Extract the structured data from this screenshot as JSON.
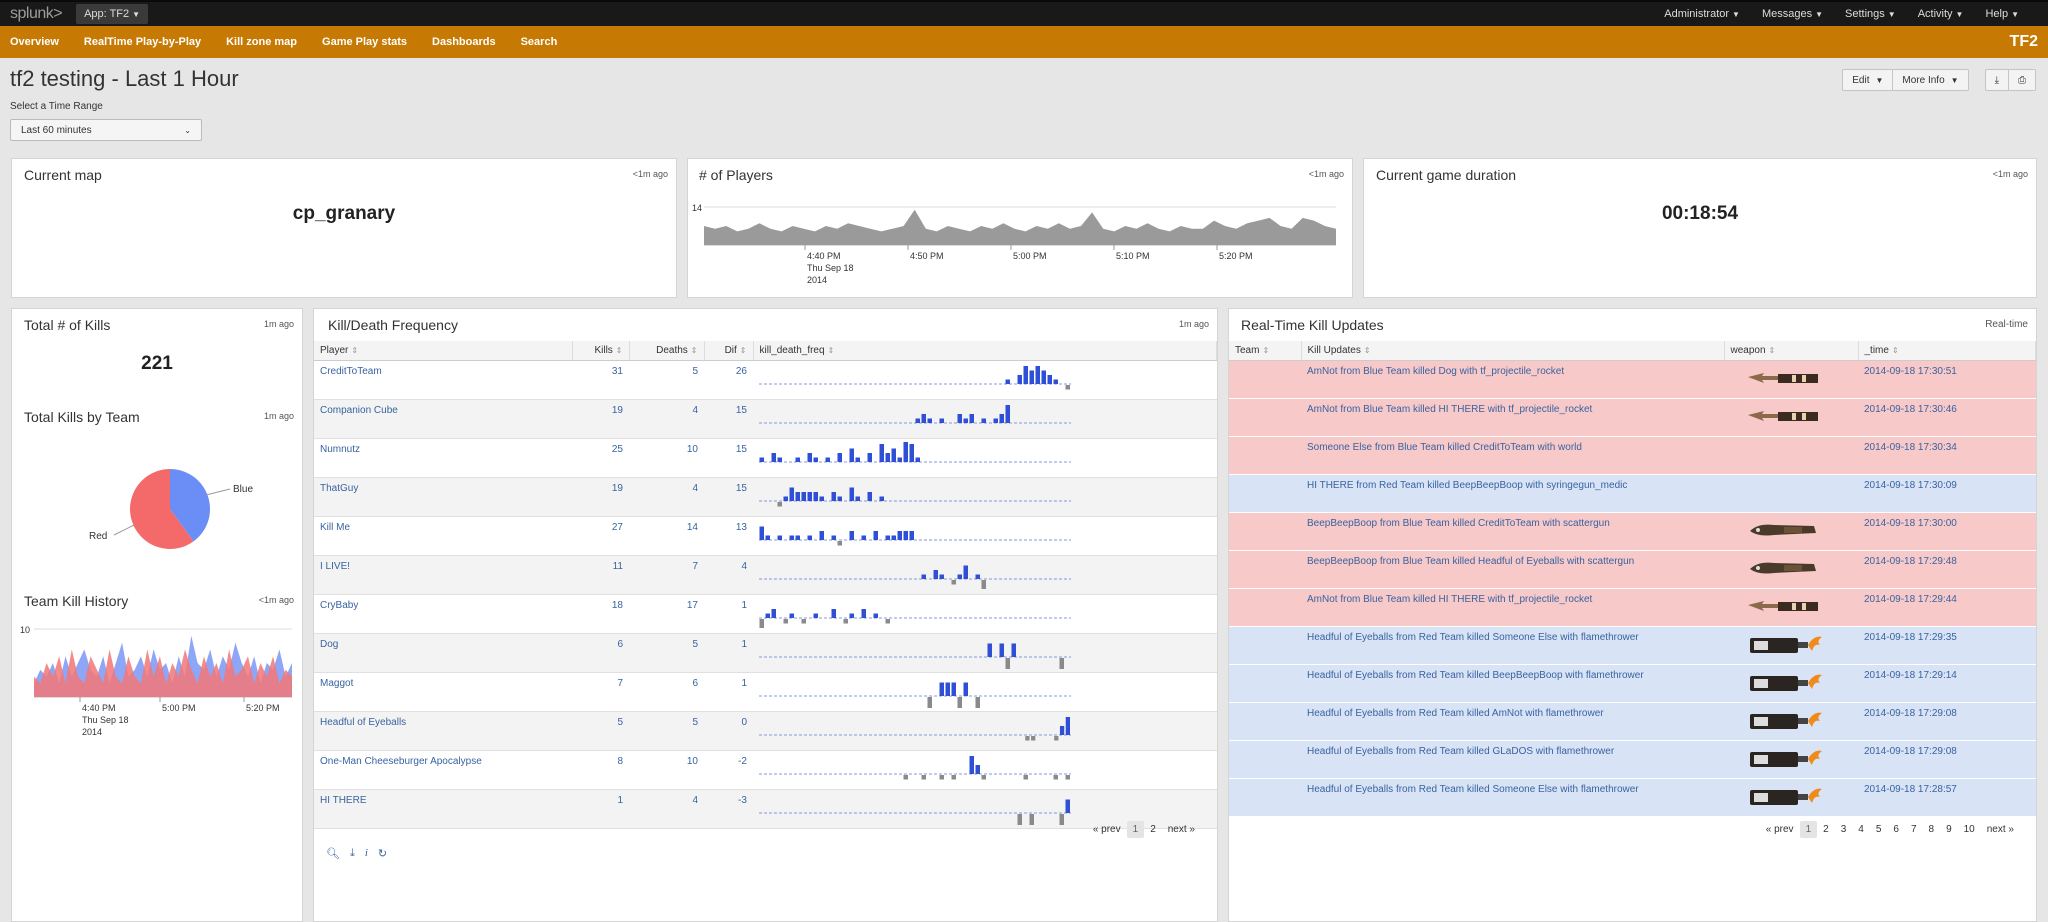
{
  "topbar": {
    "logo_main": "splunk",
    "logo_tail": ">",
    "app": "App: TF2",
    "menus": [
      "Administrator",
      "Messages",
      "Settings",
      "Activity",
      "Help"
    ]
  },
  "nav": {
    "items": [
      "Overview",
      "RealTime Play-by-Play",
      "Kill zone map",
      "Game Play stats",
      "Dashboards",
      "Search"
    ],
    "brand": "TF2"
  },
  "page": {
    "title": "tf2 testing - Last 1 Hour",
    "time_label": "Select a Time Range",
    "time_value": "Last 60 minutes",
    "buttons": {
      "edit": "Edit",
      "more_info": "More Info"
    }
  },
  "panels": {
    "current_map": {
      "title": "Current map",
      "ago": "<1m ago",
      "value": "cp_granary"
    },
    "players": {
      "title": "# of Players",
      "ago": "<1m ago",
      "ymax": "14",
      "ticks": [
        "4:40 PM",
        "4:50 PM",
        "5:00 PM",
        "5:10 PM",
        "5:20 PM"
      ],
      "date1": "Thu Sep 18",
      "date2": "2014"
    },
    "duration": {
      "title": "Current game duration",
      "ago": "<1m ago",
      "value": "00:18:54"
    },
    "total_kills": {
      "title": "Total # of Kills",
      "ago": "1m ago",
      "value": "221"
    },
    "kills_by_team": {
      "title": "Total Kills by Team",
      "ago": "1m ago"
    },
    "team_kill_history": {
      "title": "Team Kill History",
      "ago": "<1m ago",
      "ymax": "10",
      "ticks": [
        "4:40 PM",
        "5:00 PM",
        "5:20 PM"
      ],
      "date1": "Thu Sep 18",
      "date2": "2014"
    },
    "kd": {
      "title": "Kill/Death Frequency",
      "ago": "1m ago",
      "headers": [
        "Player",
        "Kills",
        "Deaths",
        "Dif",
        "kill_death_freq"
      ],
      "pager": {
        "prev": "« prev",
        "pages": [
          "1",
          "2"
        ],
        "next": "next »"
      }
    },
    "rt": {
      "title": "Real-Time Kill Updates",
      "ago": "Real-time",
      "headers": [
        "Team",
        "Kill Updates",
        "weapon",
        "_time"
      ],
      "pager": {
        "prev": "« prev",
        "pages": [
          "1",
          "2",
          "3",
          "4",
          "5",
          "6",
          "7",
          "8",
          "9",
          "10"
        ],
        "next": "next »"
      }
    }
  },
  "chart_data": [
    {
      "type": "pie",
      "title": "Total Kills by Team",
      "labels": [
        "Blue",
        "Red"
      ],
      "values": [
        40,
        60
      ],
      "colors": [
        "#6a8ef5",
        "#f46a6a"
      ]
    },
    {
      "type": "area",
      "title": "# of Players",
      "ylim": [
        0,
        14
      ],
      "x": [
        "4:40 PM",
        "4:50 PM",
        "5:00 PM",
        "5:10 PM",
        "5:20 PM"
      ],
      "values": [
        7,
        6,
        7,
        5,
        6,
        8,
        6,
        5,
        7,
        6,
        5,
        7,
        6,
        8,
        7,
        6,
        5,
        6,
        7,
        13,
        6,
        5,
        7,
        6,
        5,
        7,
        6,
        8,
        6,
        5,
        7,
        6,
        8,
        6,
        7,
        12,
        6,
        5,
        7,
        6,
        8,
        6,
        5,
        7,
        6,
        6,
        9,
        7,
        6,
        8,
        9,
        10,
        7,
        6,
        10,
        9,
        7,
        6
      ]
    },
    {
      "type": "area",
      "title": "Team Kill History",
      "ylim": [
        0,
        10
      ],
      "series": [
        {
          "name": "Blue",
          "color": "#7b97f5",
          "values": [
            2,
            4,
            3,
            5,
            2,
            6,
            3,
            5,
            7,
            4,
            3,
            6,
            2,
            5,
            8,
            3,
            4,
            6,
            3,
            7,
            4,
            5,
            2,
            6,
            3,
            9,
            5,
            4,
            7,
            3,
            6,
            4,
            8,
            5,
            3,
            6,
            2,
            5,
            4,
            7,
            3,
            5
          ]
        },
        {
          "name": "Red",
          "color": "#f27777",
          "values": [
            3,
            2,
            5,
            3,
            6,
            2,
            7,
            3,
            2,
            6,
            4,
            2,
            7,
            3,
            2,
            6,
            3,
            2,
            7,
            3,
            6,
            2,
            5,
            3,
            7,
            4,
            2,
            6,
            3,
            5,
            2,
            7,
            3,
            4,
            6,
            2,
            5,
            3,
            6,
            2,
            4,
            3
          ]
        }
      ]
    }
  ],
  "kd_rows": [
    {
      "player": "CreditToTeam",
      "kills": "31",
      "deaths": "5",
      "dif": "26",
      "spark": [
        [
          0,
          0,
          0,
          0,
          0,
          0,
          0,
          0,
          0,
          0,
          0,
          0,
          0,
          0,
          0,
          0,
          0,
          0,
          0,
          0,
          0,
          0,
          0,
          0,
          0,
          0,
          0,
          0,
          0,
          0,
          0,
          0,
          0,
          0,
          0,
          0,
          0,
          0,
          0,
          0,
          0,
          1,
          0,
          2,
          4,
          3,
          4,
          3,
          2,
          1,
          0,
          -1
        ]
      ]
    },
    {
      "player": "Companion Cube",
      "kills": "19",
      "deaths": "4",
      "dif": "15",
      "spark": [
        [
          0,
          0,
          0,
          0,
          0,
          0,
          0,
          0,
          0,
          0,
          0,
          0,
          0,
          0,
          0,
          0,
          0,
          0,
          0,
          0,
          0,
          0,
          0,
          0,
          0,
          0,
          1,
          2,
          1,
          0,
          1,
          0,
          0,
          2,
          1,
          2,
          0,
          1,
          0,
          1,
          2,
          4,
          0,
          0,
          0,
          0,
          0,
          0,
          0,
          0,
          0,
          0
        ]
      ]
    },
    {
      "player": "Numnutz",
      "kills": "25",
      "deaths": "10",
      "dif": "15",
      "spark": [
        [
          1,
          0,
          2,
          1,
          0,
          0,
          1,
          0,
          2,
          1,
          0,
          1,
          0,
          2,
          0,
          3,
          1,
          0,
          2,
          0,
          4,
          2,
          3,
          1,
          5,
          4,
          1,
          0,
          0,
          0,
          0,
          0,
          0,
          0,
          0,
          0,
          0,
          0,
          0,
          0,
          0,
          0,
          0,
          0,
          0,
          0,
          0,
          0,
          0,
          0,
          0,
          0
        ]
      ]
    },
    {
      "player": "ThatGuy",
      "kills": "19",
      "deaths": "4",
      "dif": "15",
      "spark": [
        [
          0,
          0,
          0,
          -1,
          1,
          3,
          2,
          2,
          2,
          2,
          1,
          0,
          2,
          1,
          0,
          3,
          1,
          0,
          2,
          0,
          1,
          0,
          0,
          0,
          0,
          0,
          0,
          0,
          0,
          0,
          0,
          0,
          0,
          0,
          0,
          0,
          0,
          0,
          0,
          0,
          0,
          0,
          0,
          0,
          0,
          0,
          0,
          0,
          0,
          0,
          0,
          0
        ]
      ]
    },
    {
      "player": "Kill Me",
      "kills": "27",
      "deaths": "14",
      "dif": "13",
      "spark": [
        [
          3,
          1,
          0,
          1,
          0,
          1,
          1,
          0,
          1,
          0,
          2,
          0,
          1,
          -1,
          0,
          2,
          0,
          1,
          0,
          2,
          0,
          1,
          1,
          2,
          2,
          2,
          0,
          0,
          0,
          0,
          0,
          0,
          0,
          0,
          0,
          0,
          0,
          0,
          0,
          0,
          0,
          0,
          0,
          0,
          0,
          0,
          0,
          0,
          0,
          0,
          0,
          0
        ]
      ]
    },
    {
      "player": "I LIVE!",
      "kills": "11",
      "deaths": "7",
      "dif": "4",
      "spark": [
        [
          0,
          0,
          0,
          0,
          0,
          0,
          0,
          0,
          0,
          0,
          0,
          0,
          0,
          0,
          0,
          0,
          0,
          0,
          0,
          0,
          0,
          0,
          0,
          0,
          0,
          0,
          0,
          1,
          0,
          2,
          1,
          0,
          -1,
          1,
          3,
          0,
          1,
          -2,
          0,
          0,
          0,
          0,
          0,
          0,
          0,
          0,
          0,
          0,
          0,
          0,
          0,
          0
        ]
      ]
    },
    {
      "player": "CryBaby",
      "kills": "18",
      "deaths": "17",
      "dif": "1",
      "spark": [
        [
          -2,
          1,
          2,
          0,
          -1,
          1,
          0,
          -1,
          0,
          1,
          0,
          0,
          2,
          0,
          -1,
          1,
          0,
          2,
          0,
          1,
          0,
          -1,
          0,
          0,
          0,
          0,
          0,
          0,
          0,
          0,
          0,
          0,
          0,
          0,
          0,
          0,
          0,
          0,
          0,
          0,
          0,
          0,
          0,
          0,
          0,
          0,
          0,
          0,
          0,
          0,
          0,
          0
        ]
      ]
    },
    {
      "player": "Dog",
      "kills": "6",
      "deaths": "5",
      "dif": "1",
      "spark": [
        [
          0,
          0,
          0,
          0,
          0,
          0,
          0,
          0,
          0,
          0,
          0,
          0,
          0,
          0,
          0,
          0,
          0,
          0,
          0,
          0,
          0,
          0,
          0,
          0,
          0,
          0,
          0,
          0,
          0,
          0,
          0,
          0,
          0,
          0,
          0,
          0,
          0,
          0,
          3,
          0,
          3,
          -3,
          3,
          0,
          0,
          0,
          0,
          0,
          0,
          0,
          -3,
          0
        ]
      ]
    },
    {
      "player": "Maggot",
      "kills": "7",
      "deaths": "6",
      "dif": "1",
      "spark": [
        [
          0,
          0,
          0,
          0,
          0,
          0,
          0,
          0,
          0,
          0,
          0,
          0,
          0,
          0,
          0,
          0,
          0,
          0,
          0,
          0,
          0,
          0,
          0,
          0,
          0,
          0,
          0,
          0,
          -3,
          0,
          3,
          3,
          3,
          -3,
          3,
          0,
          -3,
          0,
          0,
          0,
          0,
          0,
          0,
          0,
          0,
          0,
          0,
          0,
          0,
          0,
          0,
          0
        ]
      ]
    },
    {
      "player": "Headful of Eyeballs",
      "kills": "5",
      "deaths": "5",
      "dif": "0",
      "spark": [
        [
          0,
          0,
          0,
          0,
          0,
          0,
          0,
          0,
          0,
          0,
          0,
          0,
          0,
          0,
          0,
          0,
          0,
          0,
          0,
          0,
          0,
          0,
          0,
          0,
          0,
          0,
          0,
          0,
          0,
          0,
          0,
          0,
          0,
          0,
          0,
          0,
          0,
          0,
          0,
          0,
          0,
          0,
          0,
          0,
          0,
          0,
          -1,
          -1,
          0,
          0,
          0,
          -1,
          2,
          4
        ]
      ]
    },
    {
      "player": "One-Man Cheeseburger Apocalypse",
      "kills": "8",
      "deaths": "10",
      "dif": "-2",
      "spark": [
        [
          0,
          0,
          0,
          0,
          0,
          0,
          0,
          0,
          0,
          0,
          0,
          0,
          0,
          0,
          0,
          0,
          0,
          0,
          0,
          0,
          0,
          0,
          0,
          0,
          -1,
          0,
          0,
          -1,
          0,
          0,
          -1,
          0,
          -1,
          0,
          0,
          4,
          2,
          -1,
          0,
          0,
          0,
          0,
          0,
          0,
          -1,
          0,
          0,
          0,
          0,
          -1,
          0,
          -1
        ]
      ]
    },
    {
      "player": "HI THERE",
      "kills": "1",
      "deaths": "4",
      "dif": "-3",
      "spark": [
        [
          0,
          0,
          0,
          0,
          0,
          0,
          0,
          0,
          0,
          0,
          0,
          0,
          0,
          0,
          0,
          0,
          0,
          0,
          0,
          0,
          0,
          0,
          0,
          0,
          0,
          0,
          0,
          0,
          0,
          0,
          0,
          0,
          0,
          0,
          0,
          0,
          0,
          0,
          0,
          0,
          0,
          0,
          0,
          -3,
          0,
          -3,
          0,
          0,
          0,
          0,
          -3,
          3
        ]
      ]
    }
  ],
  "rt_rows": [
    {
      "team": "red",
      "text": "AmNot from Blue Team killed Dog with tf_projectile_rocket",
      "weapon": "rocket",
      "time": "2014-09-18 17:30:51"
    },
    {
      "team": "red",
      "text": "AmNot from Blue Team killed HI THERE with tf_projectile_rocket",
      "weapon": "rocket",
      "time": "2014-09-18 17:30:46"
    },
    {
      "team": "red",
      "text": "Someone Else from Blue Team killed CreditToTeam with world",
      "weapon": "",
      "time": "2014-09-18 17:30:34"
    },
    {
      "team": "blue",
      "text": "HI THERE from Red Team killed BeepBeepBoop with syringegun_medic",
      "weapon": "",
      "time": "2014-09-18 17:30:09"
    },
    {
      "team": "red",
      "text": "BeepBeepBoop from Blue Team killed CreditToTeam with scattergun",
      "weapon": "scattergun",
      "time": "2014-09-18 17:30:00"
    },
    {
      "team": "red",
      "text": "BeepBeepBoop from Blue Team killed Headful of Eyeballs with scattergun",
      "weapon": "scattergun",
      "time": "2014-09-18 17:29:48"
    },
    {
      "team": "red",
      "text": "AmNot from Blue Team killed HI THERE with tf_projectile_rocket",
      "weapon": "rocket",
      "time": "2014-09-18 17:29:44"
    },
    {
      "team": "blue",
      "text": "Headful of Eyeballs from Red Team killed Someone Else with flamethrower",
      "weapon": "flamethrower",
      "time": "2014-09-18 17:29:35"
    },
    {
      "team": "blue",
      "text": "Headful of Eyeballs from Red Team killed BeepBeepBoop with flamethrower",
      "weapon": "flamethrower",
      "time": "2014-09-18 17:29:14"
    },
    {
      "team": "blue",
      "text": "Headful of Eyeballs from Red Team killed AmNot with flamethrower",
      "weapon": "flamethrower",
      "time": "2014-09-18 17:29:08"
    },
    {
      "team": "blue",
      "text": "Headful of Eyeballs from Red Team killed GLaDOS with flamethrower",
      "weapon": "flamethrower",
      "time": "2014-09-18 17:29:08"
    },
    {
      "team": "blue",
      "text": "Headful of Eyeballs from Red Team killed Someone Else with flamethrower",
      "weapon": "flamethrower",
      "time": "2014-09-18 17:28:57"
    }
  ]
}
